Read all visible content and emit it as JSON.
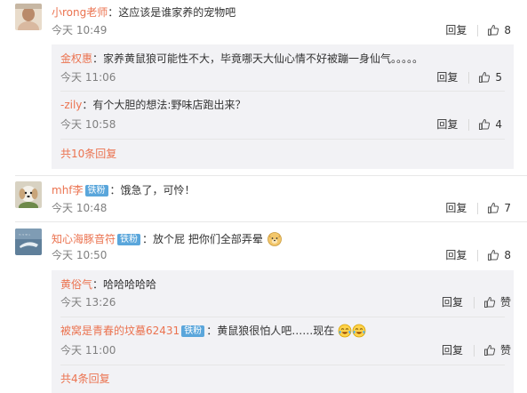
{
  "colors": {
    "username": "#eb7350",
    "badge": "#5aa6db",
    "subbg": "#f2f2f5",
    "meta": "#808080"
  },
  "comments": [
    {
      "user": "小rong老师",
      "text": "：这应该是谁家养的宠物吧",
      "time": "今天 10:49",
      "reply": "回复",
      "likes": "8"
    },
    {
      "user": "mhf李",
      "badge": "铁粉",
      "text": "：饿急了，可怜！",
      "time": "今天 10:48",
      "reply": "回复",
      "likes": "7"
    },
    {
      "user": "知心海豚音符",
      "badge": "铁粉",
      "text": "：放个屁 把你们全部弄晕",
      "time": "今天 10:50",
      "reply": "回复",
      "likes": "8"
    }
  ],
  "replies1": [
    {
      "user": "金权惠",
      "text": "：家养黄鼠狼可能性不大，毕竟哪天大仙心情不好被蹦一身仙气。。。。。",
      "time": "今天 11:06",
      "reply": "回复",
      "likes": "5"
    },
    {
      "user": "-zily",
      "text": "：有个大胆的想法:野味店跑出来？",
      "time": "今天 10:58",
      "reply": "回复",
      "likes": "4"
    }
  ],
  "replies3": [
    {
      "user": "黄俗气",
      "text": "：哈哈哈哈哈",
      "time": "今天 13:26",
      "reply": "回复",
      "likes": "赞"
    },
    {
      "user": "被窝是青春的坟墓62431",
      "badge": "铁粉",
      "text": "：黄鼠狼很怕人吧……现在",
      "time": "今天 11:00",
      "reply": "回复",
      "likes": "赞"
    }
  ],
  "more1": "共10条回复",
  "more3": "共4条回复",
  "icons": {
    "like": "thumb-up-icon",
    "emoji_dog": "doge-emoji-icon",
    "emoji_cry": "laugh-cry-emoji-icon"
  }
}
